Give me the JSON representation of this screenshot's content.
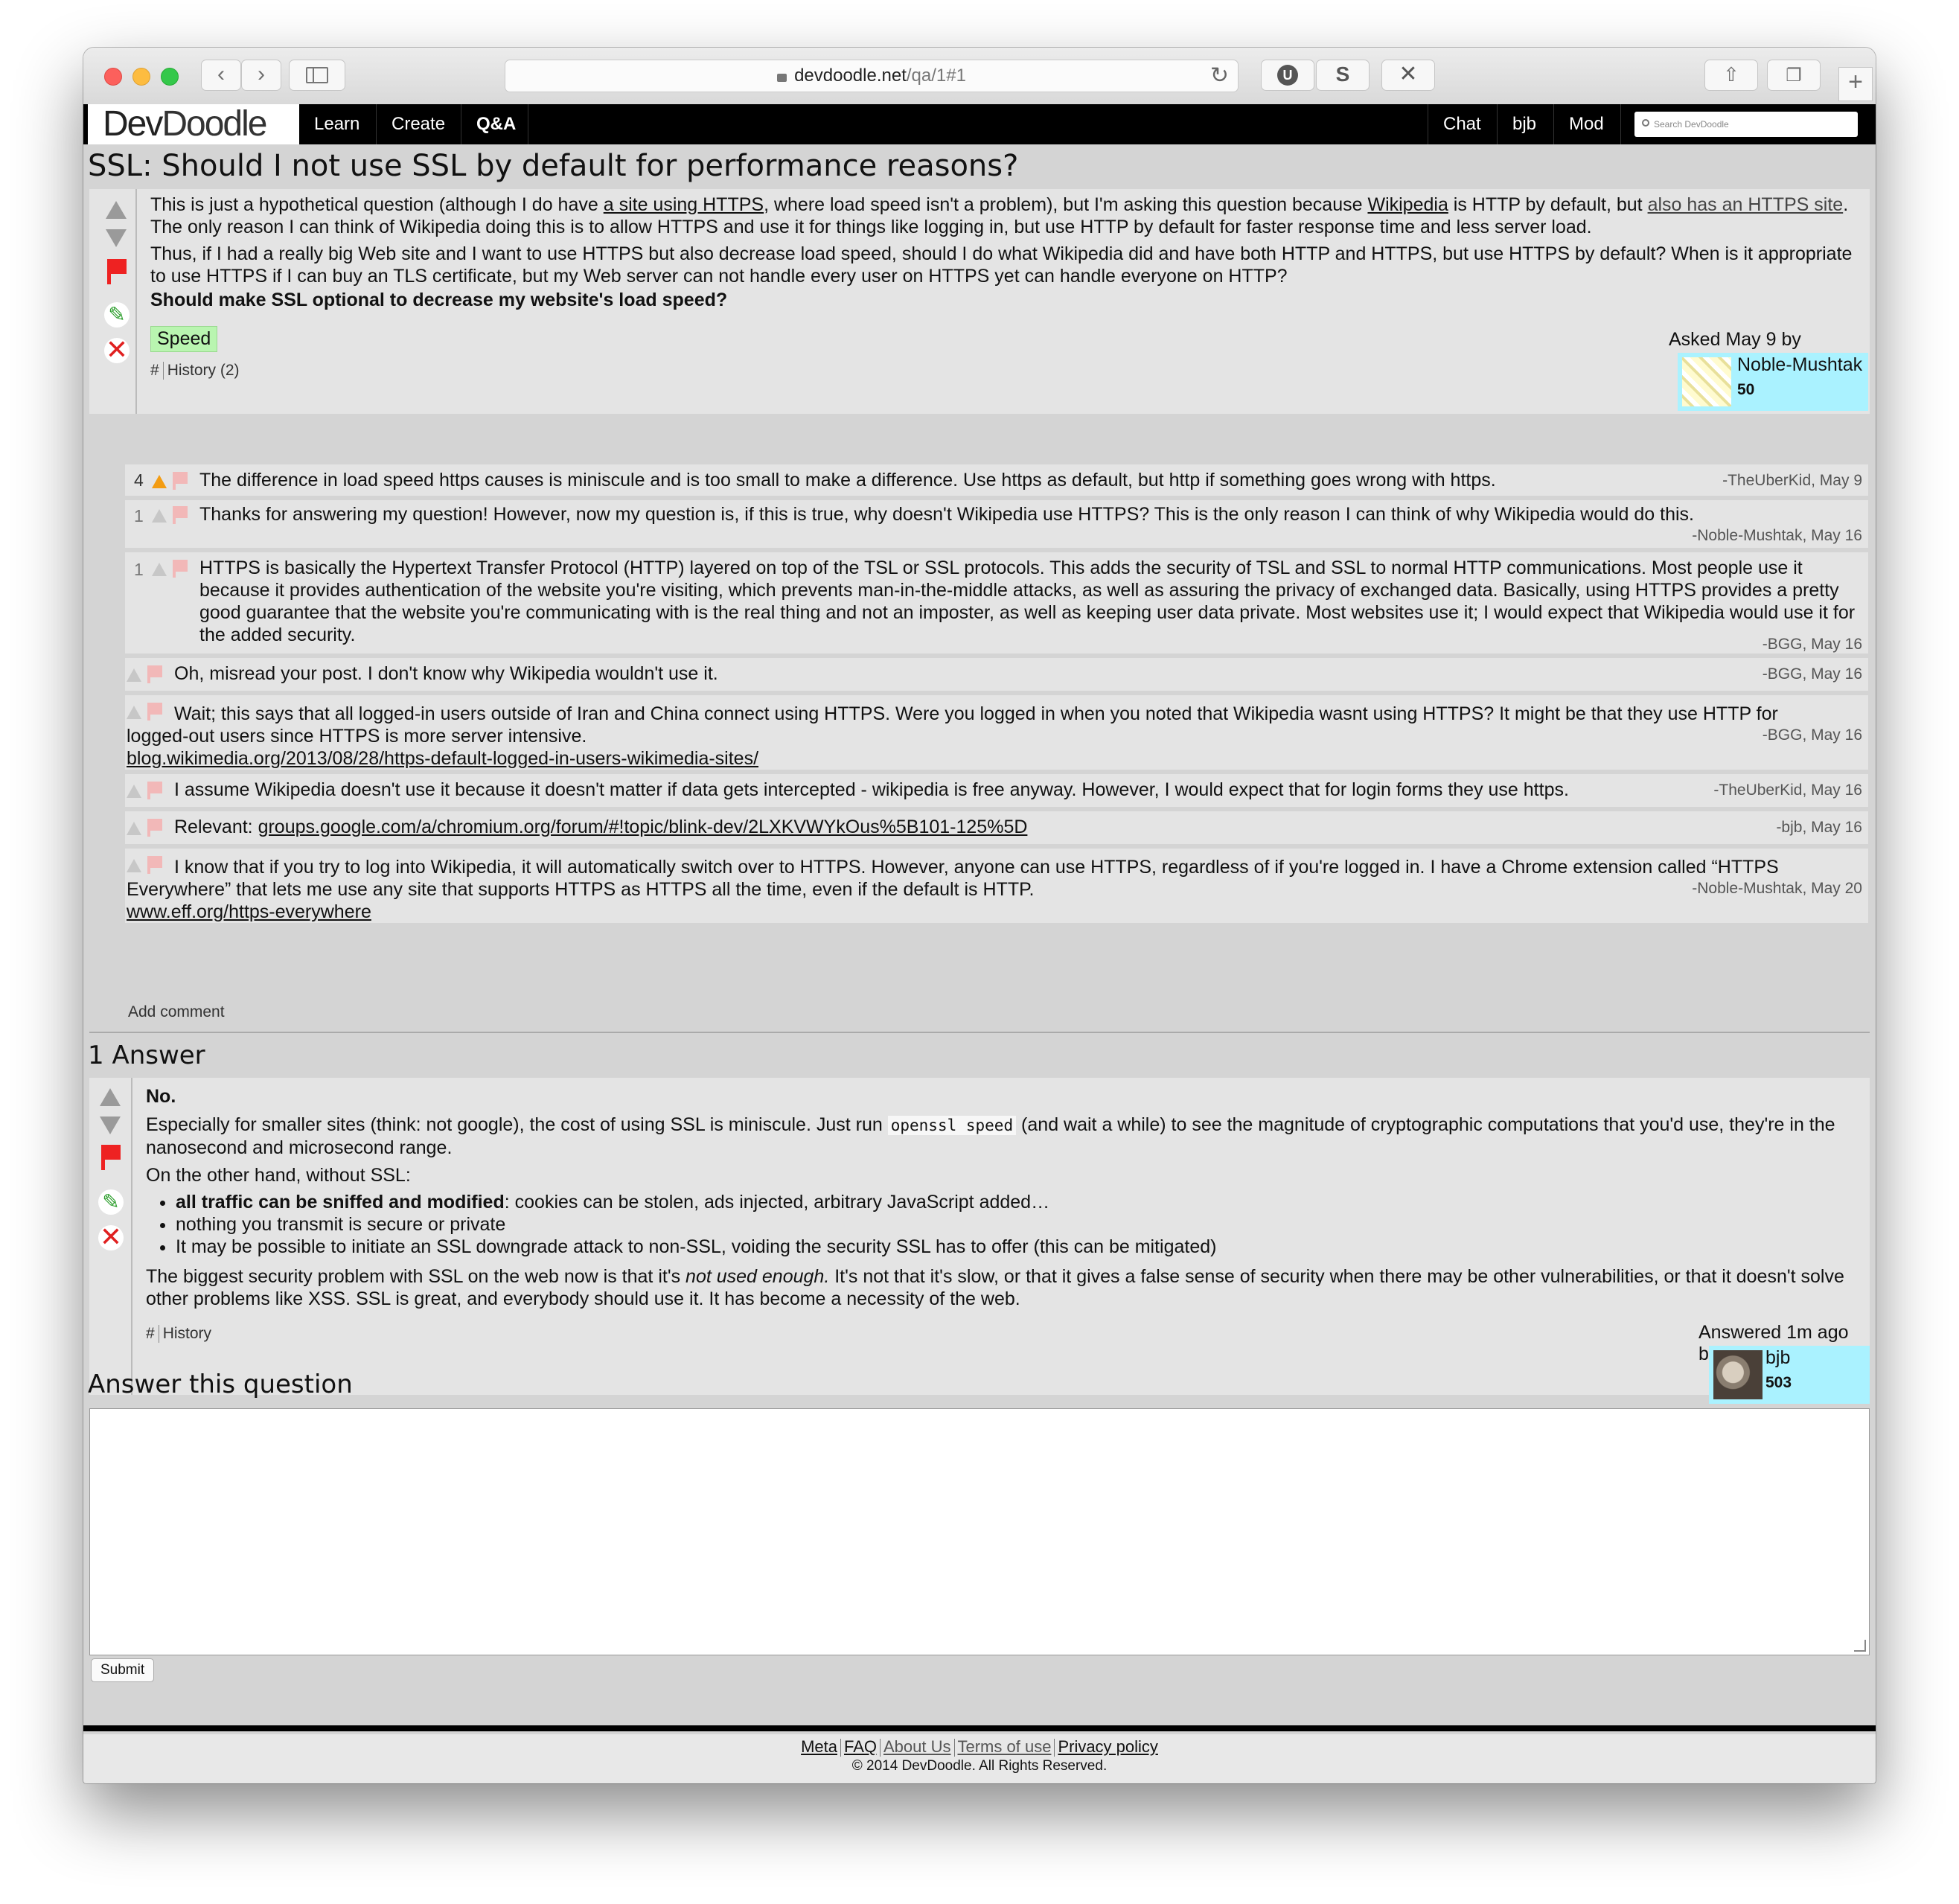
{
  "browser": {
    "url_host": "devdoodle.net",
    "url_path": "/qa/1#1"
  },
  "site": {
    "logo_dev": "Dev",
    "logo_doodle": "Doodle",
    "nav": [
      "Learn",
      "Create",
      "Q&A"
    ],
    "nav_right": [
      "Chat",
      "bjb",
      "Mod"
    ],
    "search_placeholder": "Search DevDoodle"
  },
  "question": {
    "title": "SSL: Should I not use SSL by default for performance reasons?",
    "p1_a": "This is just a hypothetical question (although I do have ",
    "p1_link1": "a site using HTTPS",
    "p1_b": ", where load speed isn't a problem), but I'm asking this question because ",
    "p1_link2": "Wikipedia",
    "p1_c": " is HTTP by default, but ",
    "p1_link3": "also has an HTTPS site",
    "p1_d": ". The only reason I can think of Wikipedia doing this is to allow HTTPS and use it for things like logging in, but use HTTP by default for faster response time and less server load.",
    "p2": "Thus, if I had a really big Web site and I want to use HTTPS but also decrease load speed, should I do what Wikipedia did and have both HTTP and HTTPS, but use HTTPS by default? When is it appropriate to use HTTPS if I can buy an TLS certificate, but my Web server can not handle every user on HTTPS yet can handle everyone on HTTP?",
    "p3": "Should make SSL optional to decrease my website's load speed?",
    "tag": "Speed",
    "hash": "#",
    "history": "History (2)",
    "asked": "Asked May 9 by",
    "user_name": "Noble-Mushtak",
    "user_rep": "50"
  },
  "comments": [
    {
      "score": "4",
      "text": "The difference in load speed https causes is miniscule and is too small to make a difference. Use https as default, but http if something goes wrong with https.",
      "author": "-TheUberKid, May 9"
    },
    {
      "score": "1",
      "text": "Thanks for answering my question! However, now my question is, if this is true, why doesn't Wikipedia use HTTPS? This is the only reason I can think of why Wikipedia would do this.",
      "author": "-Noble-Mushtak, May 16"
    },
    {
      "score": "1",
      "text": "HTTPS is basically the Hypertext Transfer Protocol (HTTP) layered on top of the TSL or SSL protocols. This adds the security of TSL and SSL to normal HTTP communications. Most people use it because it provides authentication of the website you're visiting, which prevents man-in-the-middle attacks, as well as assuring the privacy of exchanged data. Basically, using HTTPS provides a pretty good guarantee that the website you're communicating with is the real thing and not an imposter, as well as keeping user data private. Most websites use it; I would expect that Wikipedia would use it for the added security.",
      "author": "-BGG, May 16"
    },
    {
      "score": "",
      "text": "Oh, misread your post. I don't know why Wikipedia wouldn't use it.",
      "author": "-BGG, May 16"
    },
    {
      "score": "",
      "text": "Wait; this says that all logged-in users outside of Iran and China connect using HTTPS. Were you logged in when you noted that Wikipedia wasnt using HTTPS? It might be that they use HTTP for logged-out users since HTTPS is more server intensive.",
      "link": "blog.wikimedia.org/2013/08/28/https-default-logged-in-users-wikimedia-sites/",
      "author": "-BGG, May 16"
    },
    {
      "score": "",
      "text": "I assume Wikipedia doesn't use it because it doesn't matter if data gets intercepted - wikipedia is free anyway. However, I would expect that for login forms they use https.",
      "author": "-TheUberKid, May 16"
    },
    {
      "score": "",
      "text": "Relevant: ",
      "link": "groups.google.com/a/chromium.org/forum/#!topic/blink-dev/2LXKVWYkOus%5B101-125%5D",
      "author": "-bjb, May 16"
    },
    {
      "score": "",
      "text": "I know that if you try to log into Wikipedia, it will automatically switch over to HTTPS. However, anyone can use HTTPS, regardless of if you're logged in. I have a Chrome extension called “HTTPS Everywhere” that lets me use any site that supports HTTPS as HTTPS all the time, even if the default is HTTP.",
      "link": "www.eff.org/https-everywhere",
      "author": "-Noble-Mushtak, May 20"
    }
  ],
  "add_comment": "Add comment",
  "answers_heading": "1 Answer",
  "answer": {
    "p1": "No.",
    "p2_a": "Especially for smaller sites (think: not google), the cost of using SSL is miniscule. Just run ",
    "p2_code": "openssl speed",
    "p2_b": " (and wait a while) to see the magnitude of cryptographic computations that you'd use, they're in the nanosecond and microsecond range.",
    "p3": "On the other hand, without SSL:",
    "li1_bold": "all traffic can be sniffed and modified",
    "li1_rest": ": cookies can be stolen, ads injected, arbitrary JavaScript added…",
    "li2": "nothing you transmit is secure or private",
    "li3": "It may be possible to initiate an SSL downgrade attack to non-SSL, voiding the security SSL has to offer (this can be mitigated)",
    "p4_a": "The biggest security problem with SSL on the web now is that it's ",
    "p4_em": "not used enough.",
    "p4_b": " It's not that it's slow, or that it gives a false sense of security when there may be other vulnerabilities, or that it doesn't solve other problems like XSS. SSL is great, and everybody should use it. It has become a necessity of the web.",
    "hash": "#",
    "history": "History",
    "answered": "Answered 1m ago by",
    "user_name": "bjb",
    "user_rep": "503"
  },
  "answer_form": {
    "heading": "Answer this question",
    "submit": "Submit"
  },
  "footer": {
    "links": [
      "Meta",
      "FAQ",
      "About Us",
      "Terms of use",
      "Privacy policy"
    ],
    "copyright": "© 2014 DevDoodle. All Rights Reserved."
  },
  "colors": {
    "tag_bg": "#b9f5b0",
    "user_box": "#aaf2ff",
    "flag": "#ee2222",
    "upvote_active": "#f39c12"
  }
}
